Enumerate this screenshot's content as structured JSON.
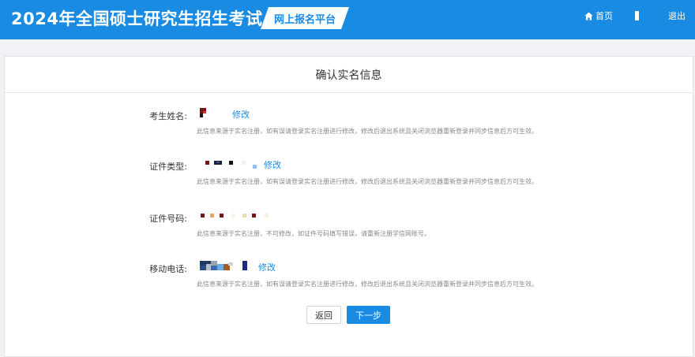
{
  "header": {
    "site_title": "2024年全国硕士研究生招生考试",
    "badge": "网上报名平台",
    "home_label": "首页",
    "logout_label": "退出"
  },
  "card": {
    "title": "确认实名信息",
    "fields": [
      {
        "label": "考生姓名:",
        "edit_label": "修改",
        "note": "此信息来源于实名注册，如有误请登录实名注册进行修改，修改后退出系统且关闭浏览器重新登录并同步信息后方可生效。"
      },
      {
        "label": "证件类型:",
        "edit_label": "修改",
        "note": "此信息来源于实名注册，如有误请登录实名注册进行修改，修改后退出系统且关闭浏览器重新登录并同步信息后方可生效。"
      },
      {
        "label": "证件号码:",
        "note": "此信息来源于实名注册，不可修改，如证件号码填写错误，请重新注册学信网账号。"
      },
      {
        "label": "移动电话:",
        "edit_label": "修改",
        "note": "此信息来源于实名注册，如有误请登录实名注册进行修改，修改后退出系统且关闭浏览器重新登录并同步信息后方可生效。"
      }
    ],
    "back_label": "返回",
    "next_label": "下一步"
  },
  "colors": {
    "primary": "#1a8be3",
    "page_bg": "#f1f2f5"
  },
  "icons": {
    "home": "home-icon"
  }
}
